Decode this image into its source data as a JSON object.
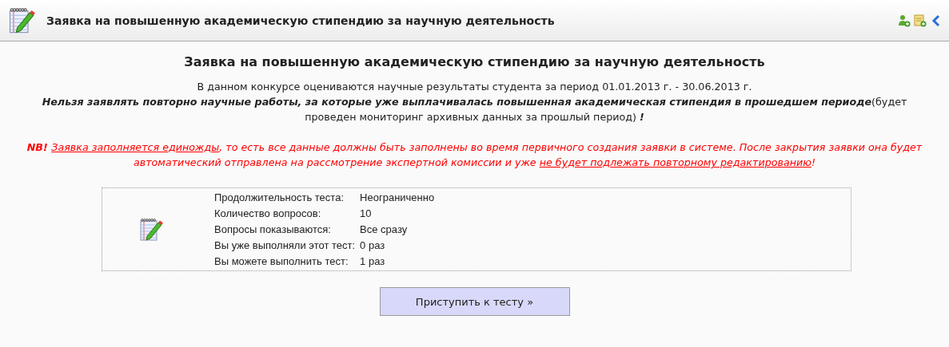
{
  "header": {
    "title": "Заявка на повышенную академическую стипендию за научную деятельность"
  },
  "heading": "Заявка на повышенную академическую стипендию за научную деятельность",
  "period_text": "В данном конкурсе оцениваются научные результаты студента за период 01.01.2013 г. - 30.06.2013 г.",
  "warning": [
    {
      "kind": "emphasis",
      "text": "Нельзя заявлять повторно научные работы, за которые уже выплачивалась повышенная академическая стипендия в прошедшем периоде"
    },
    {
      "kind": "normal",
      "text": "(будет проведен мониторинг архивных данных за прошлый период) "
    },
    {
      "kind": "emphasis",
      "text": "!"
    }
  ],
  "nb_notice": [
    {
      "kind": "marker",
      "text": "NB! "
    },
    {
      "kind": "highlight",
      "text": "Заявка заполняется единожды"
    },
    {
      "kind": "normal",
      "text": ", то есть все данные должны быть заполнены во время первичного создания заявки в системе. После закрытия заявки она будет автоматический отправлена  на рассмотрение экспертной комиссии и уже "
    },
    {
      "kind": "highlight",
      "text": "не будет подлежать повторному редактированию"
    },
    {
      "kind": "normal",
      "text": "!"
    }
  ],
  "test_info": [
    {
      "label": "Продолжительность теста:",
      "value": "Неограниченно"
    },
    {
      "label": "Количество вопросов:",
      "value": "10"
    },
    {
      "label": "Вопросы показываются:",
      "value": "Все сразу"
    },
    {
      "label": "Вы уже выполняли этот тест:",
      "value": "0 раз"
    },
    {
      "label": "Вы можете выполнить тест:",
      "value": "1 раз"
    }
  ],
  "start_button": "Приступить к тесту »"
}
